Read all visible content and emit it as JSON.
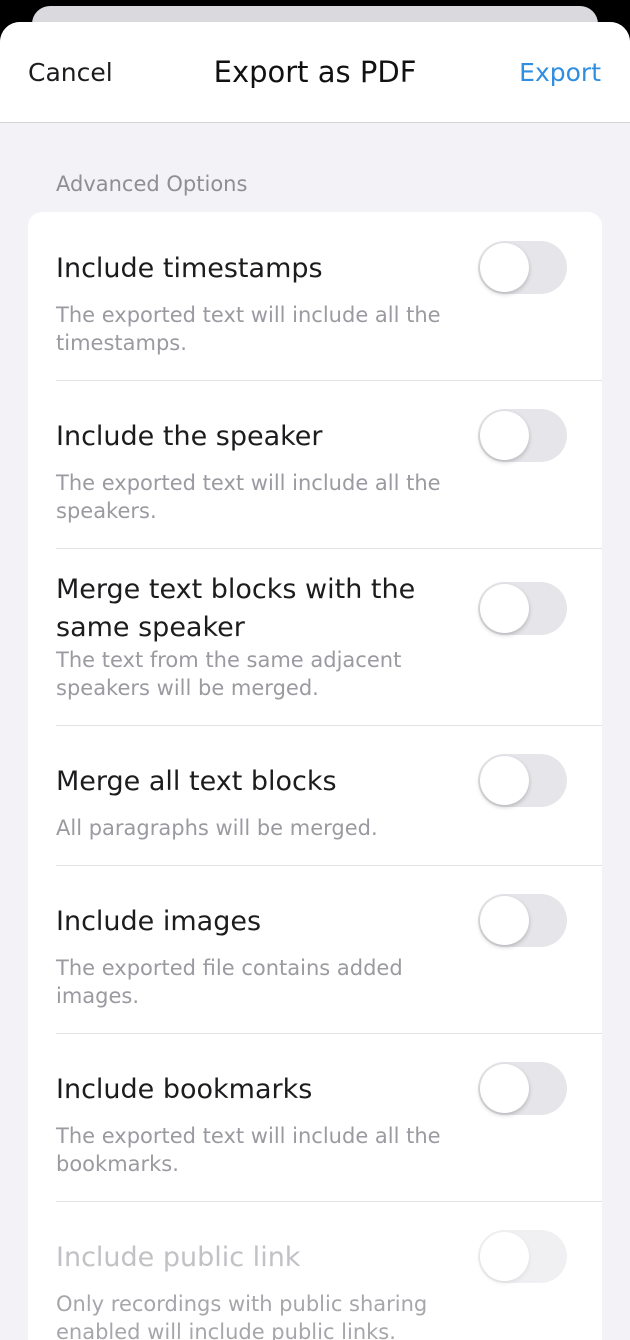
{
  "nav": {
    "cancel_label": "Cancel",
    "title": "Export as PDF",
    "export_label": "Export"
  },
  "section": {
    "header": "Advanced Options"
  },
  "options": [
    {
      "title": "Include timestamps",
      "description": "The exported text will include all the timestamps.",
      "enabled": false
    },
    {
      "title": "Include the speaker",
      "description": "The exported text will include all the speakers.",
      "enabled": false
    },
    {
      "title": "Merge text blocks with the same speaker",
      "description": "The text from the same adjacent speakers will be merged.",
      "enabled": false
    },
    {
      "title": "Merge all text blocks",
      "description": "All paragraphs will be merged.",
      "enabled": false
    },
    {
      "title": "Include images",
      "description": "The exported file contains added images.",
      "enabled": false
    },
    {
      "title": "Include bookmarks",
      "description": "The exported text will include all the bookmarks.",
      "enabled": false
    },
    {
      "title": "Include public link",
      "description": "Only recordings with public sharing enabled will include public links.",
      "enabled": false,
      "disabled": true
    }
  ],
  "colors": {
    "accent": "#2f8ee0",
    "background": "#f2f2f7",
    "card": "#ffffff",
    "toggle_off": "#e6e6ea"
  }
}
